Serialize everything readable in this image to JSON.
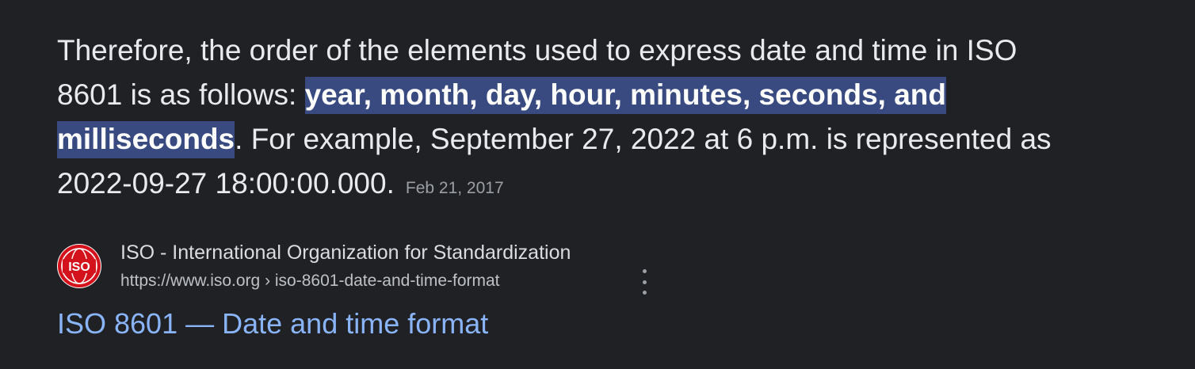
{
  "snippet": {
    "text_before": "Therefore, the order of the elements used to express date and time in ISO 8601 is as follows: ",
    "highlight": "year, month, day, hour, minutes, seconds, and milliseconds",
    "text_after": ". For example, September 27, 2022 at 6 p.m. is represented as 2022-09-27 18:00:00.000.",
    "date": "Feb 21, 2017"
  },
  "source": {
    "favicon_text": "ISO",
    "favicon_color": "#d4121b",
    "site_name": "ISO - International Organization for Standardization",
    "url": "https://www.iso.org › iso-8601-date-and-time-format",
    "menu_icon": "more-vert-icon"
  },
  "result": {
    "title": "ISO 8601 — Date and time format",
    "link_color": "#8ab4f8"
  },
  "colors": {
    "background": "#202124",
    "highlight_bg": "#394a80"
  }
}
